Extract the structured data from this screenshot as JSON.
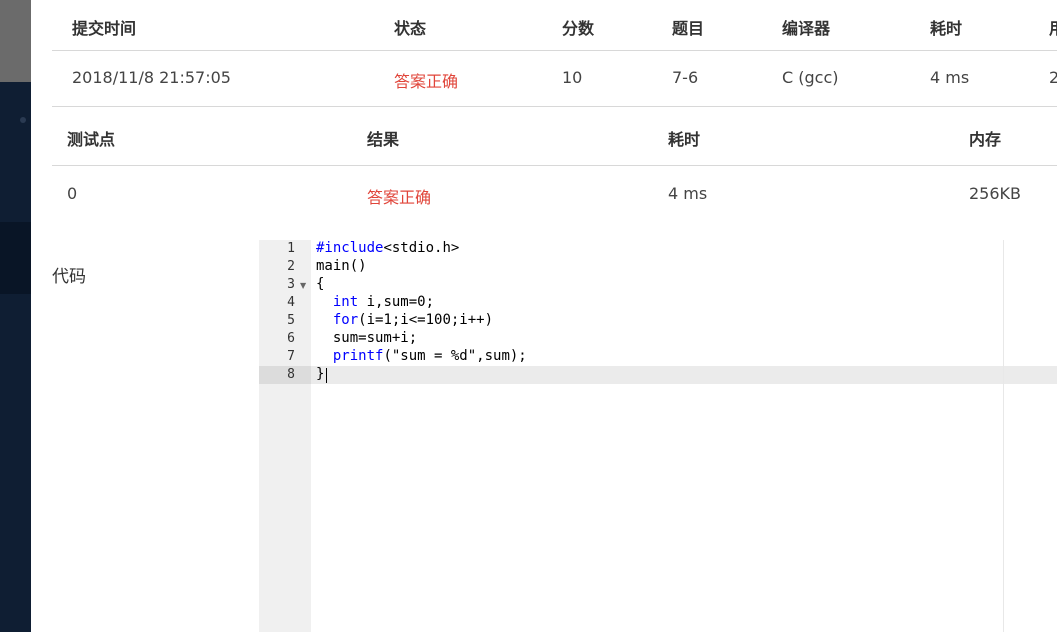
{
  "submission": {
    "headers": [
      "提交时间",
      "状态",
      "分数",
      "题目",
      "编译器",
      "耗时",
      "用"
    ],
    "row": [
      "2018/11/8 21:57:05",
      "答案正确",
      "10",
      "7-6",
      "C (gcc)",
      "4 ms",
      "2"
    ]
  },
  "testcases": {
    "headers": [
      "测试点",
      "结果",
      "耗时",
      "内存"
    ],
    "rows": [
      [
        "0",
        "答案正确",
        "4 ms",
        "256KB"
      ]
    ]
  },
  "code_section": {
    "label": "代码",
    "line_numbers": [
      "1",
      "2",
      "3",
      "4",
      "5",
      "6",
      "7",
      "8"
    ],
    "lines": [
      "#include<stdio.h>",
      "main()",
      "{",
      "  int i,sum=0;",
      "  for(i=1;i<=100;i++)",
      "  sum=sum+i;",
      "  printf(\"sum = %d\",sum);",
      "}"
    ]
  },
  "colors": {
    "status_ok": "#e0453a",
    "sidebar": "#0f1e33",
    "keyword": "#0000ff"
  },
  "icons": {
    "fold": "fold-arrow-icon"
  }
}
